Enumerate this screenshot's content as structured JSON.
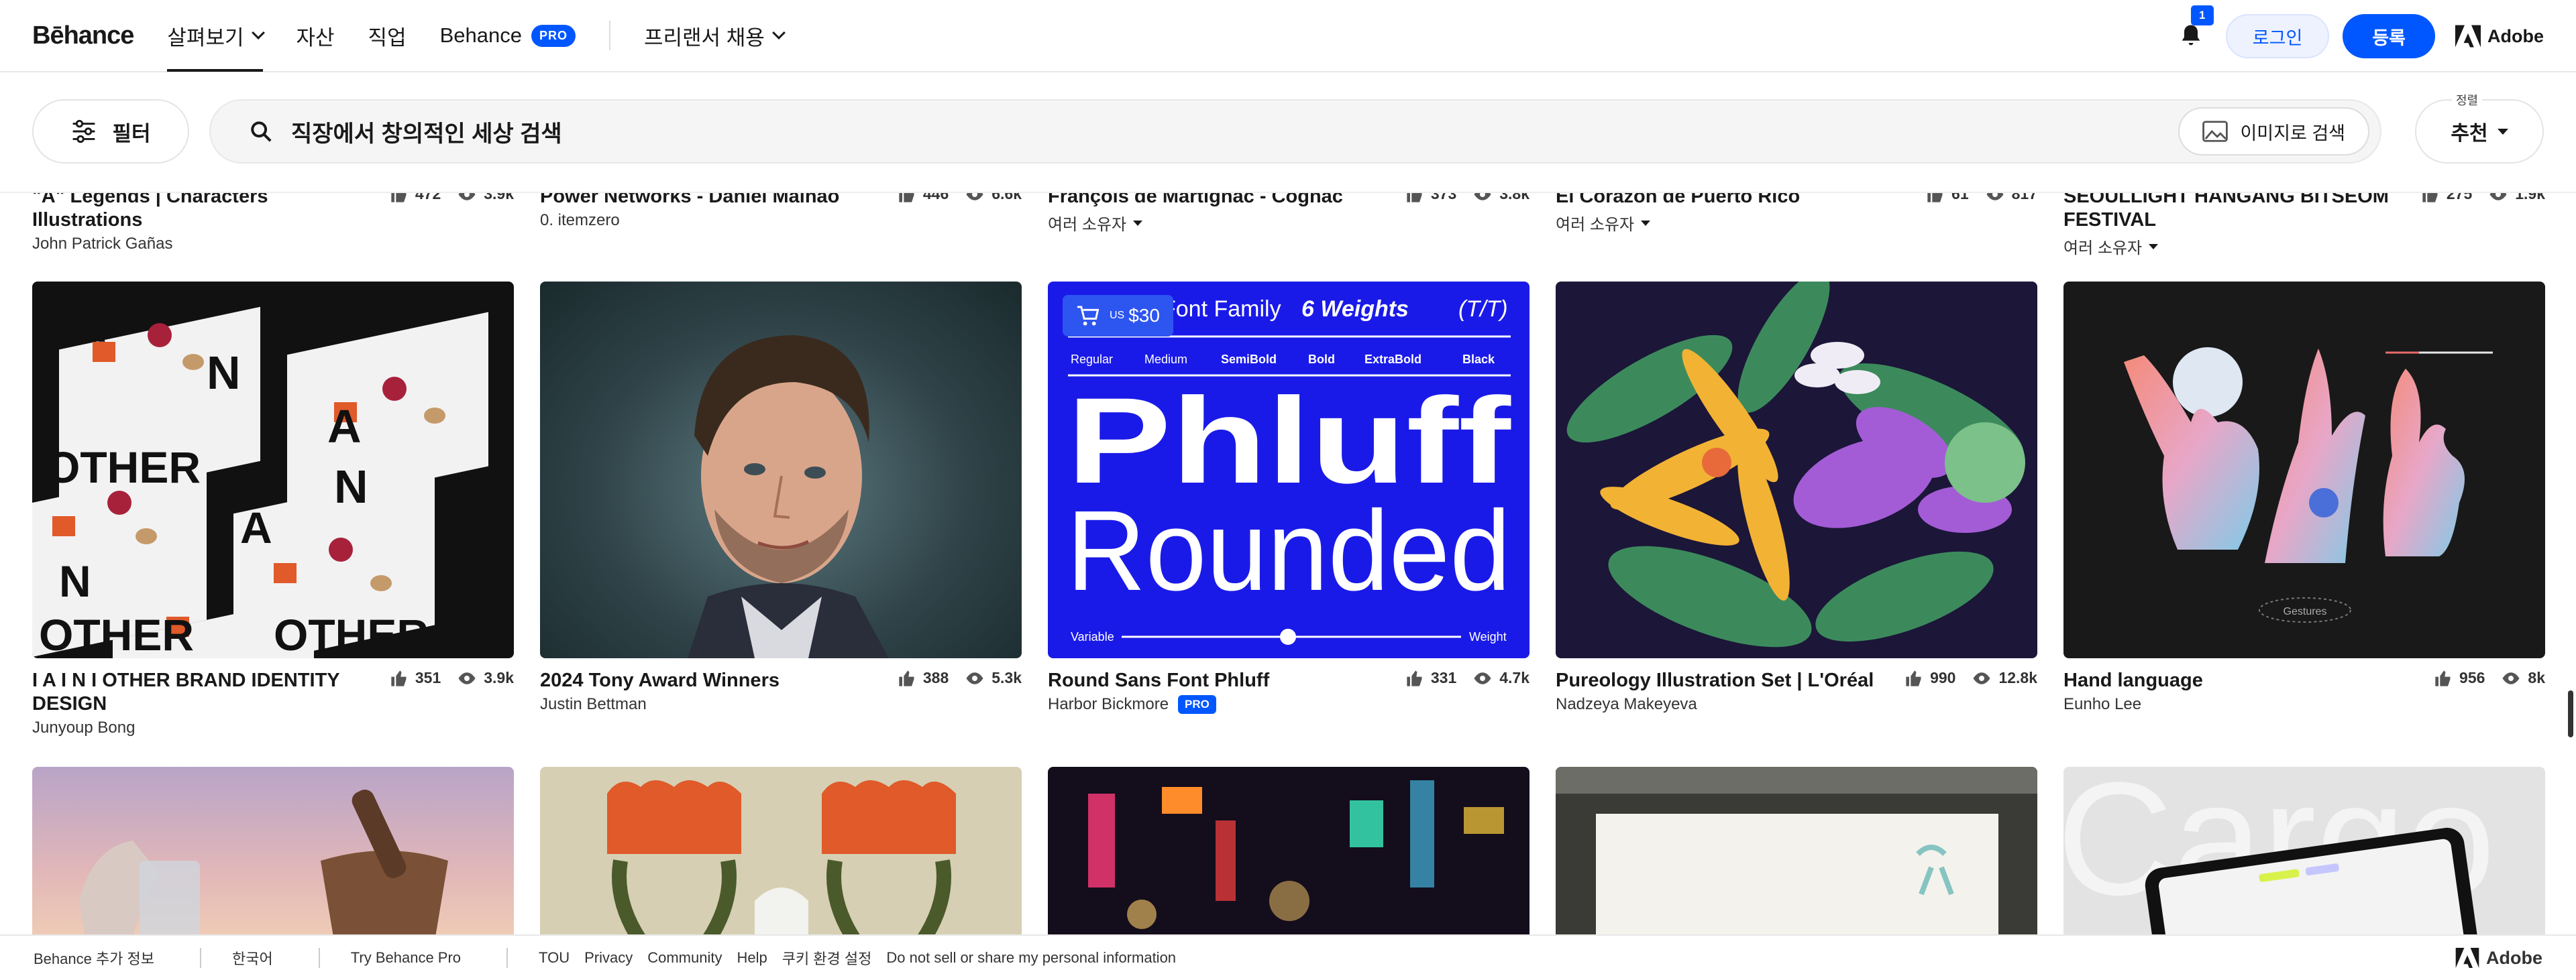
{
  "nav": {
    "logo": "Bēhance",
    "explore": "살펴보기",
    "assets": "자산",
    "jobs": "직업",
    "behance": "Behance",
    "pro_badge": "PRO",
    "hire": "프리랜서 채용",
    "notif_count": "1",
    "login": "로그인",
    "signup": "등록",
    "adobe": "Adobe"
  },
  "search": {
    "filter": "필터",
    "placeholder": "직장에서 창의적인 세상 검색",
    "image_search": "이미지로 검색",
    "sort_label": "정렬",
    "sort_value": "추천"
  },
  "row1": [
    {
      "title": "\"A\" Legends | Characters Illustrations",
      "owner": "John Patrick Gañas",
      "likes": "472",
      "views": "3.9k"
    },
    {
      "title": "Power Networks - Daniel Malhão",
      "owner": "0. itemzero",
      "likes": "446",
      "views": "6.6k"
    },
    {
      "title": "François de Martignac - Cognac",
      "owner": "여러 소유자",
      "likes": "373",
      "views": "3.8k"
    },
    {
      "title": "El Corazón de Puerto Rico",
      "owner": "여러 소유자",
      "likes": "61",
      "views": "817"
    },
    {
      "title": "SEOULLIGHT HANGANG BITSEOM FESTIVAL",
      "owner": "여러 소유자",
      "likes": "275",
      "views": "1.9k"
    }
  ],
  "row2": [
    {
      "title": "I A I N I OTHER BRAND IDENTITY DESIGN",
      "owner": "Junyoup Bong",
      "likes": "351",
      "views": "3.9k"
    },
    {
      "title": "2024 Tony Award Winners",
      "owner": "Justin Bettman",
      "likes": "388",
      "views": "5.3k"
    },
    {
      "title": "Round Sans Font Phluff",
      "owner": "Harbor Bickmore",
      "likes": "331",
      "views": "4.7k",
      "owner_badge": "PRO",
      "price_currency": "US",
      "price": "$30"
    },
    {
      "title": "Pureology Illustration Set | L'Oréal",
      "owner": "Nadzeya Makeyeva",
      "likes": "990",
      "views": "12.8k"
    },
    {
      "title": "Hand language",
      "owner": "Eunho Lee",
      "likes": "956",
      "views": "8k"
    }
  ],
  "artwork": {
    "phluff_family": "Font Family",
    "phluff_weights": "6 Weights",
    "phluff_tt": "(T/T)",
    "phluff_w": [
      "Regular",
      "Medium",
      "SemiBold",
      "Bold",
      "ExtraBold",
      "Black"
    ],
    "phluff_l1": "Phluff",
    "phluff_l2": "Rounded",
    "phluff_variable": "Variable",
    "phluff_weight": "Weight",
    "iain_text": "A N OTHER",
    "gestures": "Gestures",
    "cargo": "Cargo"
  },
  "footer": {
    "more": "Behance 추가 정보",
    "lang": "한국어",
    "try": "Try Behance Pro",
    "tou": "TOU",
    "privacy": "Privacy",
    "community": "Community",
    "help": "Help",
    "cookies": "쿠키 환경 설정",
    "dns": "Do not sell or share my personal information",
    "adobe": "Adobe"
  },
  "colors": {
    "accent": "#0057ff",
    "phluff_bg": "#1a1ae8"
  }
}
